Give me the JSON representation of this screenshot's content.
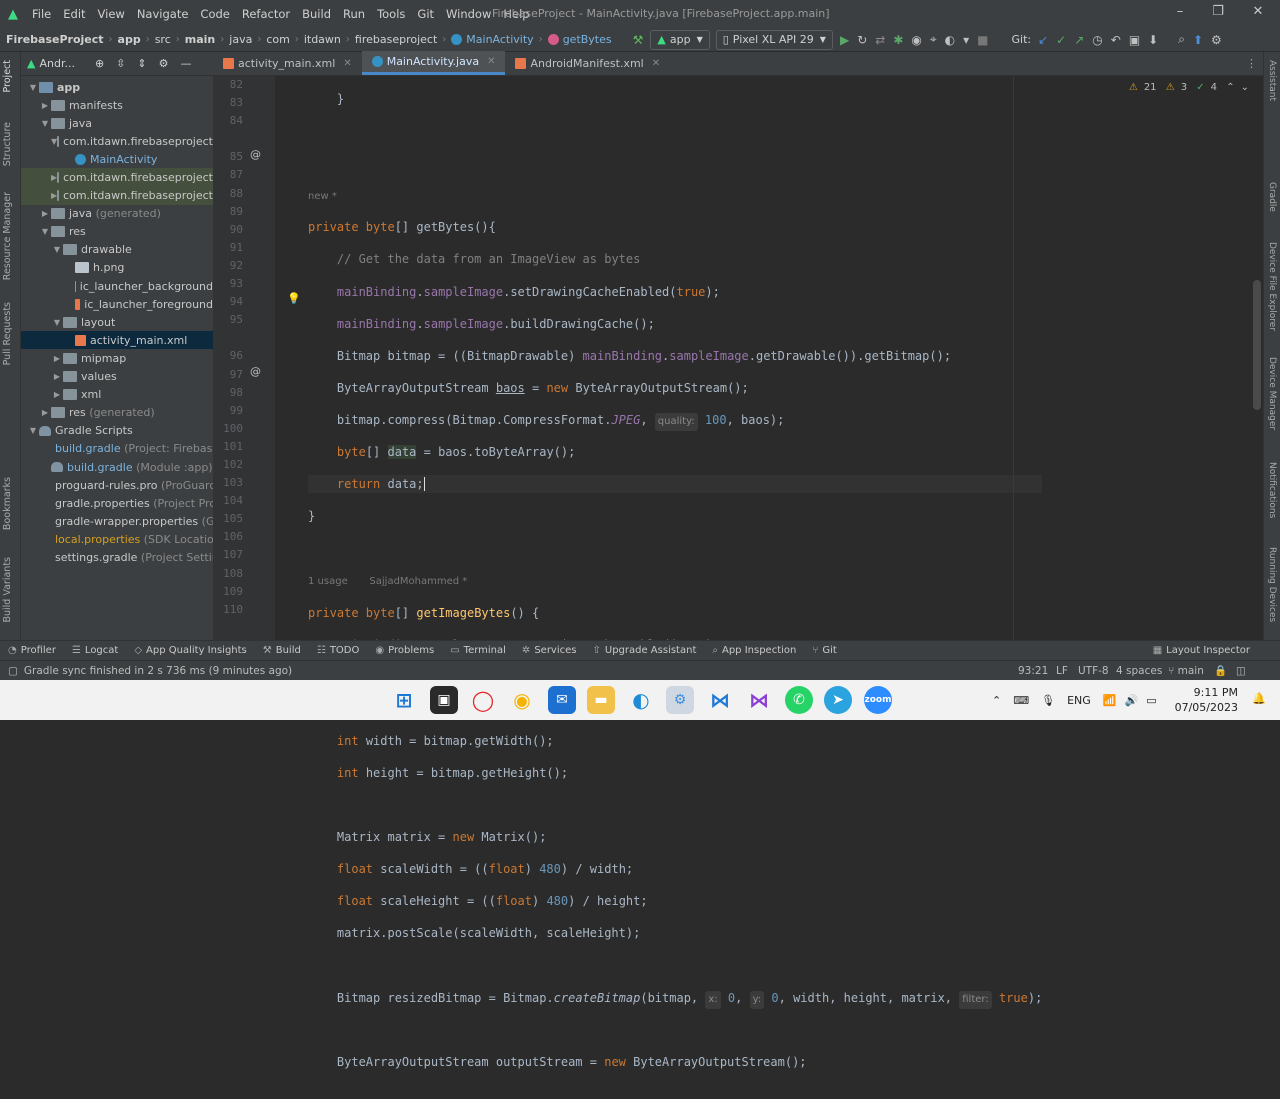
{
  "menubar": {
    "items": [
      "File",
      "Edit",
      "View",
      "Navigate",
      "Code",
      "Refactor",
      "Build",
      "Run",
      "Tools",
      "Git",
      "Window",
      "Help"
    ],
    "window_title": "FirebaseProject - MainActivity.java [FirebaseProject.app.main]"
  },
  "navbar": {
    "breadcrumbs": [
      "FirebaseProject",
      "app",
      "src",
      "main",
      "java",
      "com",
      "itdawn",
      "firebaseproject",
      "MainActivity",
      "getBytes"
    ],
    "run_config": "app",
    "device": "Pixel XL API 29",
    "git_label": "Git:"
  },
  "project_pane": {
    "header": "Andr...",
    "tree": [
      {
        "label": "app",
        "note": ""
      },
      {
        "label": "manifests",
        "note": ""
      },
      {
        "label": "java",
        "note": ""
      },
      {
        "label": "com.itdawn.firebaseproject",
        "note": ""
      },
      {
        "label": "MainActivity",
        "note": ""
      },
      {
        "label": "com.itdawn.firebaseproject",
        "note": ""
      },
      {
        "label": "com.itdawn.firebaseproject",
        "note": ""
      },
      {
        "label": "java",
        "note": "(generated)"
      },
      {
        "label": "res",
        "note": ""
      },
      {
        "label": "drawable",
        "note": ""
      },
      {
        "label": "h.png",
        "note": ""
      },
      {
        "label": "ic_launcher_background",
        "note": ""
      },
      {
        "label": "ic_launcher_foreground",
        "note": ""
      },
      {
        "label": "layout",
        "note": ""
      },
      {
        "label": "activity_main.xml",
        "note": ""
      },
      {
        "label": "mipmap",
        "note": ""
      },
      {
        "label": "values",
        "note": ""
      },
      {
        "label": "xml",
        "note": ""
      },
      {
        "label": "res",
        "note": "(generated)"
      },
      {
        "label": "Gradle Scripts",
        "note": ""
      },
      {
        "label": "build.gradle",
        "note": "(Project: Firebase"
      },
      {
        "label": "build.gradle",
        "note": "(Module :app)"
      },
      {
        "label": "proguard-rules.pro",
        "note": "(ProGuard"
      },
      {
        "label": "gradle.properties",
        "note": "(Project Prop"
      },
      {
        "label": "gradle-wrapper.properties",
        "note": "(G"
      },
      {
        "label": "local.properties",
        "note": "(SDK Location"
      },
      {
        "label": "settings.gradle",
        "note": "(Project Settin"
      }
    ]
  },
  "left_strip_labels": [
    "Project",
    "Structure",
    "Resource Manager",
    "Pull Requests",
    "Bookmarks",
    "Build Variants"
  ],
  "right_strip_labels": [
    "Assistant",
    "Gradle",
    "Device File Explorer",
    "Device Manager",
    "Notifications",
    "Running Devices"
  ],
  "editor": {
    "tabs": [
      "activity_main.xml",
      "MainActivity.java",
      "AndroidManifest.xml"
    ],
    "inspections": {
      "warnings": "21",
      "weak_warnings": "3",
      "typos": "4"
    },
    "line_numbers": [
      "82",
      "83",
      "84",
      "",
      "85",
      "87",
      "88",
      "89",
      "90",
      "91",
      "92",
      "93",
      "94",
      "95",
      "",
      "96",
      "97",
      "98",
      "99",
      "100",
      "101",
      "102",
      "103",
      "104",
      "105",
      "106",
      "107",
      "108",
      "109",
      "110"
    ],
    "hint_new": "new *",
    "hint_usage": "1 usage",
    "hint_author": "SajjadMohammed *"
  },
  "bottom_tools": [
    "Profiler",
    "Logcat",
    "App Quality Insights",
    "Build",
    "TODO",
    "Problems",
    "Terminal",
    "Services",
    "Upgrade Assistant",
    "App Inspection",
    "Git",
    "Layout Inspector"
  ],
  "status": {
    "message": "Gradle sync finished in 2 s 736 ms (9 minutes ago)",
    "position": "93:21",
    "line_sep": "LF",
    "encoding": "UTF-8",
    "indent": "4 spaces",
    "branch": "main"
  },
  "taskbar": {
    "lang": "ENG",
    "time": "9:11 PM",
    "date": "07/05/2023"
  }
}
